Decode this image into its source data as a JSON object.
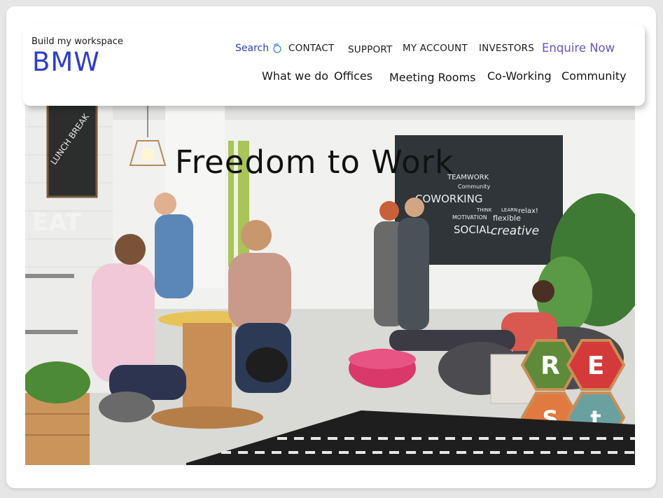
{
  "header": {
    "tagline": "Build my workspace",
    "logo": "BMW",
    "search_label": "Search",
    "utility_links": [
      "CONTACT",
      "SUPPORT",
      "MY ACCOUNT",
      "INVESTORS"
    ],
    "cta_label": "Enquire Now",
    "nav_links": [
      "What we do",
      "Offices",
      "Meeting Rooms",
      "Co-Working",
      "Community"
    ]
  },
  "hero": {
    "title": "Freedom to Work",
    "chalkboard_text": [
      "TEAMWORK",
      "Community",
      "COWORKING",
      "THINK",
      "LEARN",
      "relax!",
      "MOTIVATION",
      "flexible",
      "SOCIAL",
      "creative"
    ],
    "sign_text": [
      "LUNCH BREAK",
      "EAT"
    ],
    "rest_sign": [
      "R",
      "E",
      "S",
      "t"
    ]
  },
  "colors": {
    "brand_blue": "#2e3ec8",
    "link_blue": "#3040c0",
    "cta_purple": "#6a52c7"
  }
}
